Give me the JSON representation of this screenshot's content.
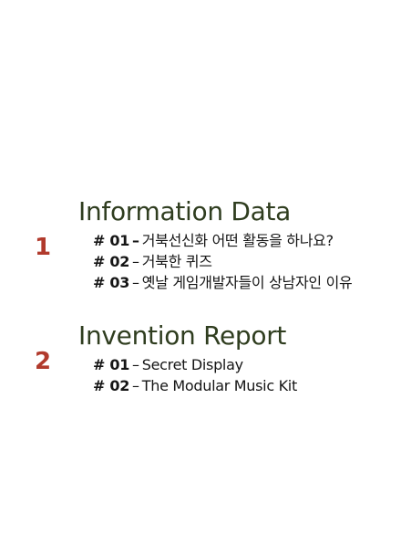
{
  "colors": {
    "title": "#2f3d1f",
    "number": "#b13a2c",
    "text": "#151515"
  },
  "sections": [
    {
      "number": "1",
      "title": "Information Data",
      "items": [
        {
          "code": "# 01",
          "dash": "–",
          "text": "거북선신화 어떤 활동을 하나요?"
        },
        {
          "code": "# 02",
          "dash": "–",
          "text": "거북한 퀴즈"
        },
        {
          "code": "# 03",
          "dash": "–",
          "text": "옛날 게임개발자들이 상남자인 이유"
        }
      ]
    },
    {
      "number": "2",
      "title": "Invention Report",
      "items": [
        {
          "code": "# 01",
          "dash": "–",
          "text": "Secret Display"
        },
        {
          "code": "# 02",
          "dash": "–",
          "text": "The Modular Music Kit"
        }
      ]
    }
  ]
}
